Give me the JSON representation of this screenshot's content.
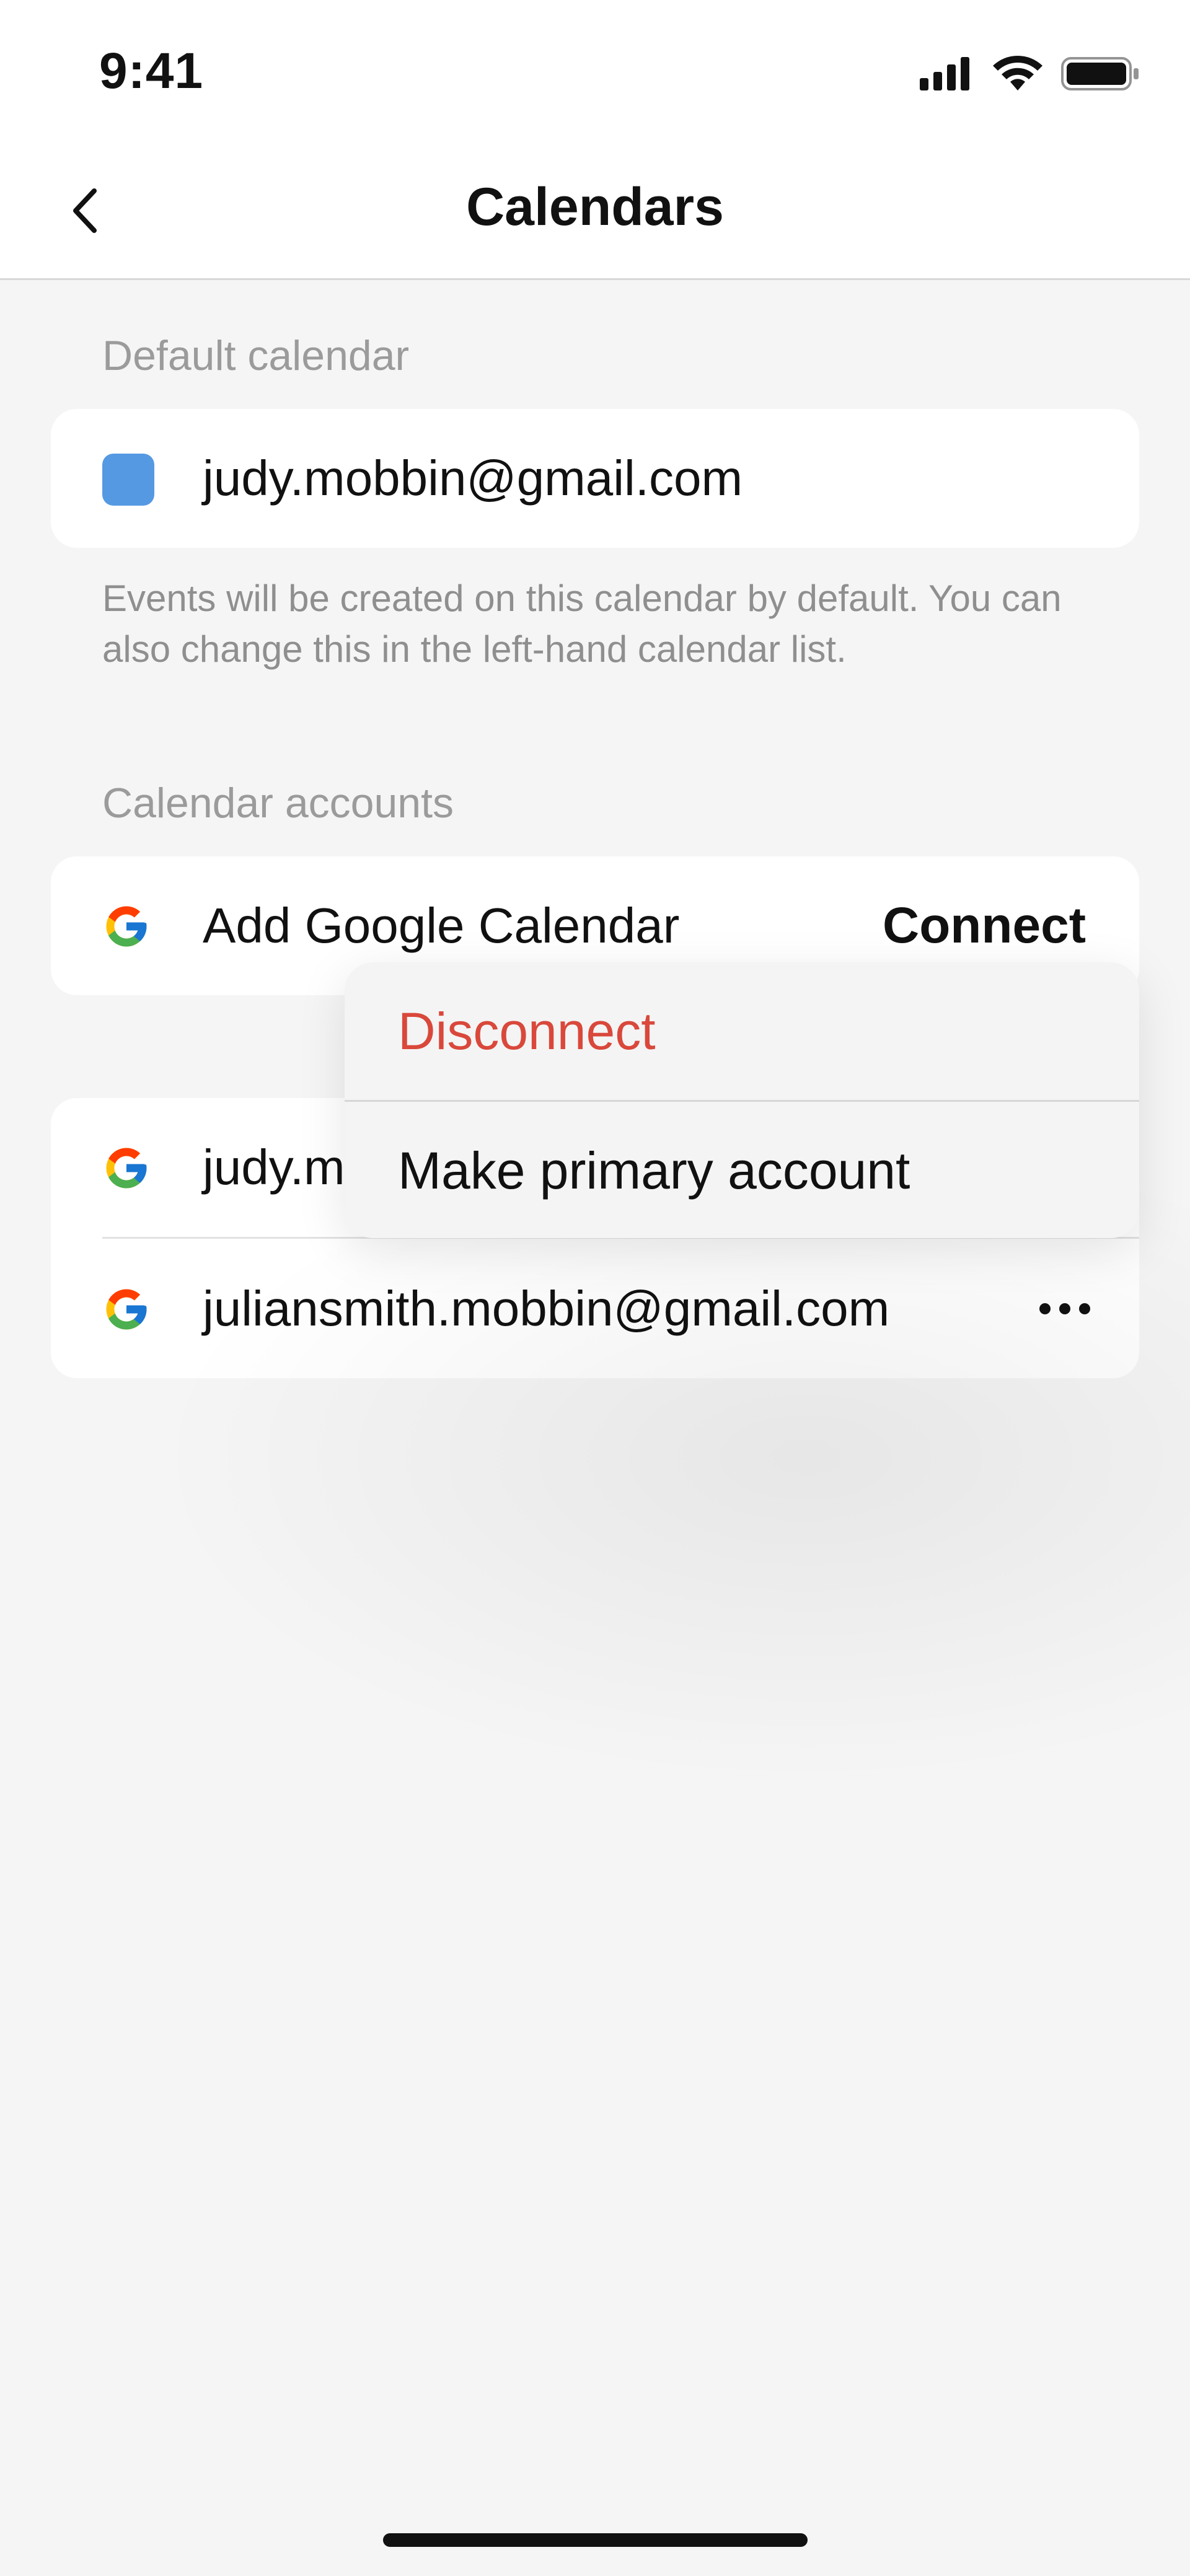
{
  "status_bar": {
    "time": "9:41",
    "icons": [
      "cellular-signal-icon",
      "wifi-icon",
      "battery-icon"
    ]
  },
  "nav": {
    "title": "Calendars",
    "back_icon": "chevron-left-icon"
  },
  "default_calendar": {
    "section_label": "Default calendar",
    "email": "judy.mobbin@gmail.com",
    "swatch_color": "#5599e3",
    "hint": "Events will be created on this calendar by default. You can also change this in the left-hand calendar list."
  },
  "calendar_accounts": {
    "section_label": "Calendar accounts",
    "add_google": {
      "label": "Add Google Calendar",
      "action": "Connect",
      "icon": "google-icon"
    },
    "accounts": [
      {
        "email": "judy.m",
        "icon": "google-icon"
      },
      {
        "email": "juliansmith.mobbin@gmail.com",
        "icon": "google-icon",
        "more_icon": "more-horizontal-icon"
      }
    ]
  },
  "context_menu": {
    "items": [
      {
        "label": "Disconnect",
        "color": "#d9483b"
      },
      {
        "label": "Make primary account",
        "color": "#111111"
      }
    ]
  }
}
